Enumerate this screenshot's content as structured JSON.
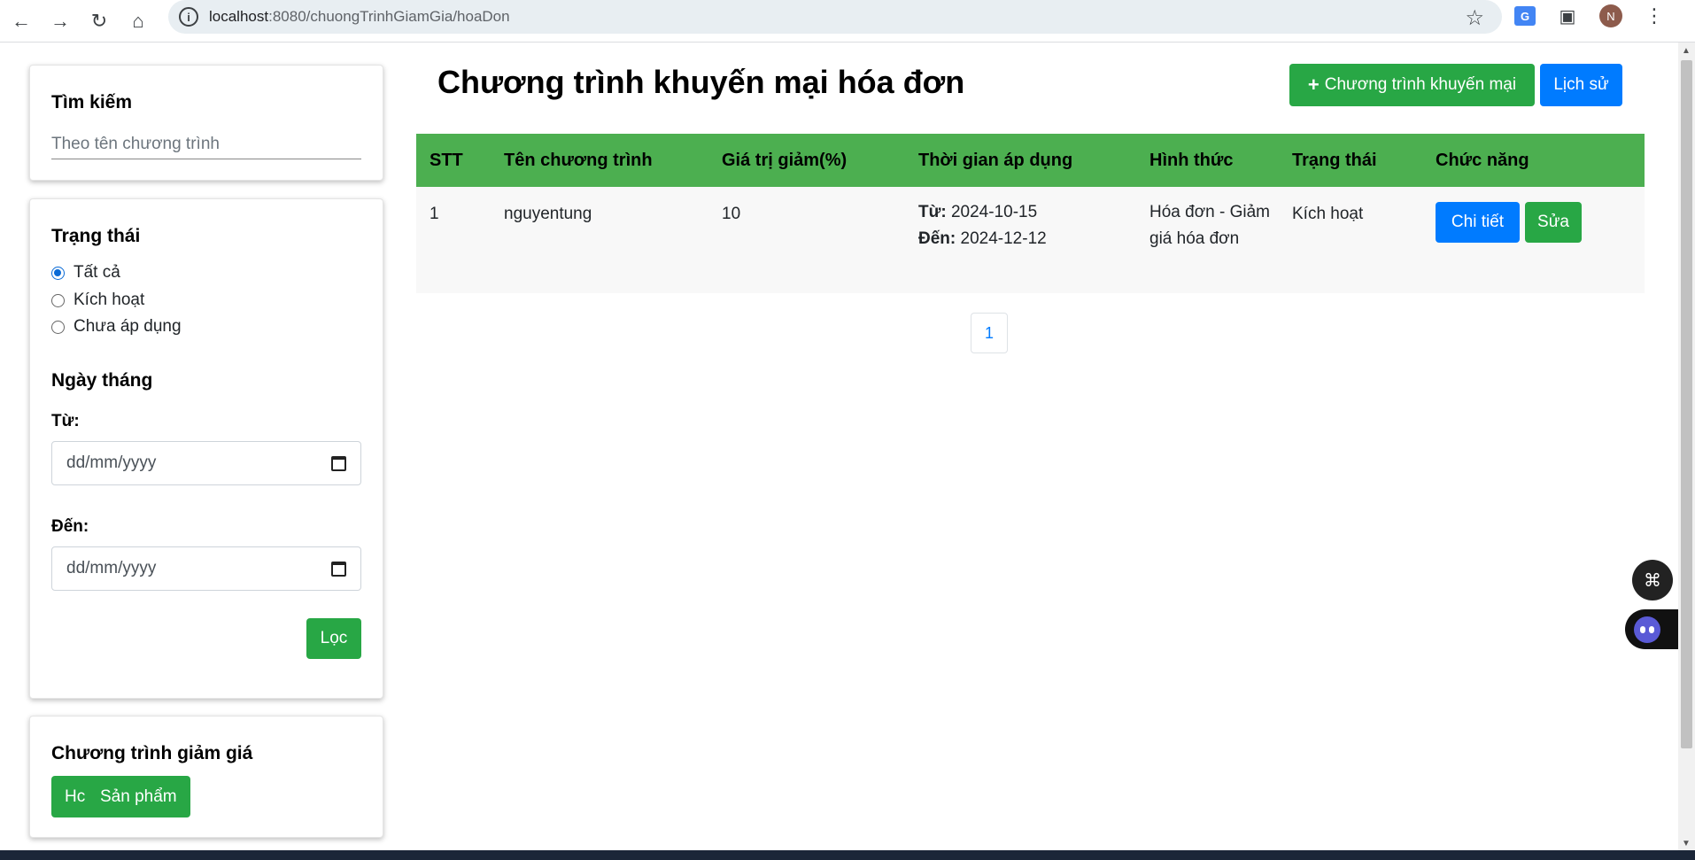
{
  "browser": {
    "url_host": "localhost",
    "url_rest": ":8080/chuongTrinhGiamGia/hoaDon",
    "avatar_initial": "N",
    "icons": [
      "back-icon",
      "forward-icon",
      "reload-icon",
      "home-icon",
      "info-icon",
      "star-icon",
      "translate-icon",
      "extensions-icon",
      "kebab-menu-icon"
    ]
  },
  "search": {
    "title": "Tìm kiếm",
    "placeholder": "Theo tên chương trình"
  },
  "filter": {
    "status_title": "Trạng thái",
    "status_options": [
      {
        "label": "Tất cả",
        "checked": true
      },
      {
        "label": "Kích hoạt",
        "checked": false
      },
      {
        "label": "Chưa áp dụng",
        "checked": false
      }
    ],
    "date_title": "Ngày tháng",
    "from_label": "Từ:",
    "to_label": "Đến:",
    "date_placeholder": "dd/mm/yyyy",
    "filter_button": "Lọc"
  },
  "promo": {
    "title": "Chương trình giảm giá",
    "button_ghost": "Hc",
    "button_label": "Sản phẩm"
  },
  "main": {
    "title": "Chương trình khuyến mại hóa đơn",
    "add_button": "Chương trình khuyến mại",
    "history_button": "Lịch sử"
  },
  "table": {
    "headers": [
      "STT",
      "Tên chương trình",
      "Giá trị giảm(%)",
      "Thời gian áp dụng",
      "Hình thức",
      "Trạng thái",
      "Chức năng"
    ],
    "rows": [
      {
        "stt": "1",
        "name": "nguyentung",
        "discount": "10",
        "from_label": "Từ:",
        "from_date": "2024-10-15",
        "to_label": "Đến:",
        "to_date": "2024-12-12",
        "type": "Hóa đơn - Giảm giá hóa đơn",
        "status": "Kích hoạt",
        "detail_button": "Chi tiết",
        "edit_button": "Sửa"
      }
    ]
  },
  "pagination": {
    "current_page": "1"
  },
  "colors": {
    "green": "#28a745",
    "table_header": "#4caf50",
    "blue": "#007bff"
  }
}
